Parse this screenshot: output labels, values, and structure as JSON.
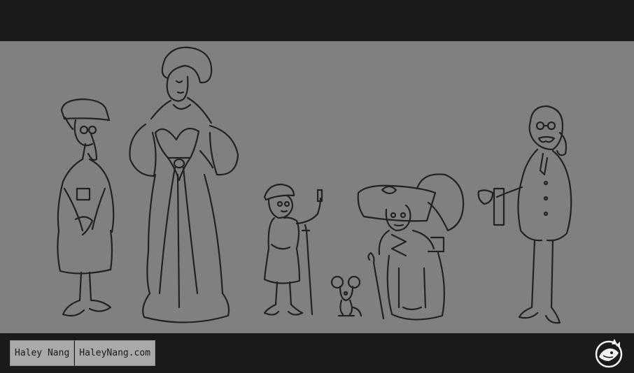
{
  "credits": {
    "artist_name": "Haley Nang",
    "website": "HaleyNang.com"
  },
  "logo": {
    "icon": "fox-head-logo-icon"
  },
  "colors": {
    "background_frame": "#1b1a19",
    "canvas": "#818080",
    "ink": "#222222",
    "chip": "#a9a9a9"
  },
  "characters": [
    "capped-man-with-glasses",
    "lady-in-gown",
    "boy-with-crutch",
    "mouse",
    "old-lady-in-big-hat",
    "tall-old-gentleman"
  ]
}
